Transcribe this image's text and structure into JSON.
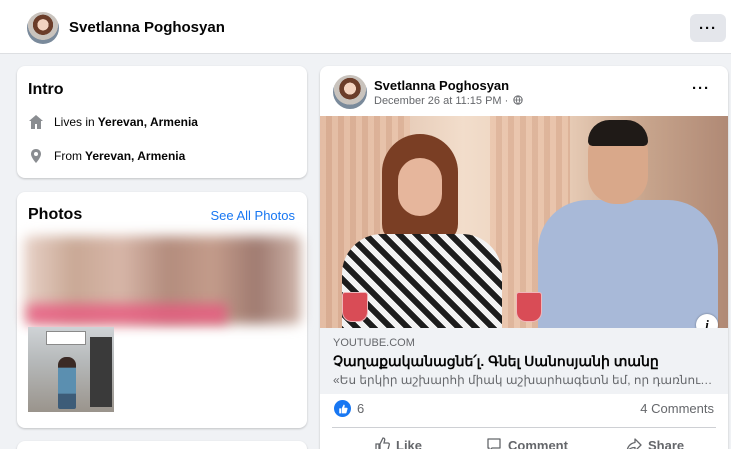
{
  "header": {
    "name": "Svetlanna Poghosyan",
    "more_label": "···"
  },
  "intro": {
    "title": "Intro",
    "lives_prefix": "Lives in",
    "lives_place": "Yerevan, Armenia",
    "from_prefix": "From",
    "from_place": "Yerevan, Armenia"
  },
  "photos": {
    "title": "Photos",
    "see_all": "See All Photos"
  },
  "post": {
    "author": "Svetlanna Poghosyan",
    "date": "December 26 at 11:15 PM ·",
    "more_label": "···",
    "info_badge": "i",
    "link": {
      "domain": "YOUTUBE.COM",
      "title": "Չաղաքականացնե՛լ. Գնել Սանոսյանի տանը",
      "description": "«Ես երկիր աշխարհի միակ աշխարհագետն եմ, որ դառնում եմ աշ..."
    },
    "reaction_count": "6",
    "comments": "4 Comments",
    "actions": {
      "like": "Like",
      "comment": "Comment",
      "share": "Share"
    }
  },
  "colors": {
    "accent": "#1877f2",
    "muted": "#65676b",
    "background": "#f0f2f5"
  },
  "icons": [
    "home-icon",
    "location-pin-icon",
    "globe-icon",
    "like-reaction-icon",
    "thumbs-up-icon",
    "comment-icon",
    "share-icon",
    "info-icon"
  ]
}
